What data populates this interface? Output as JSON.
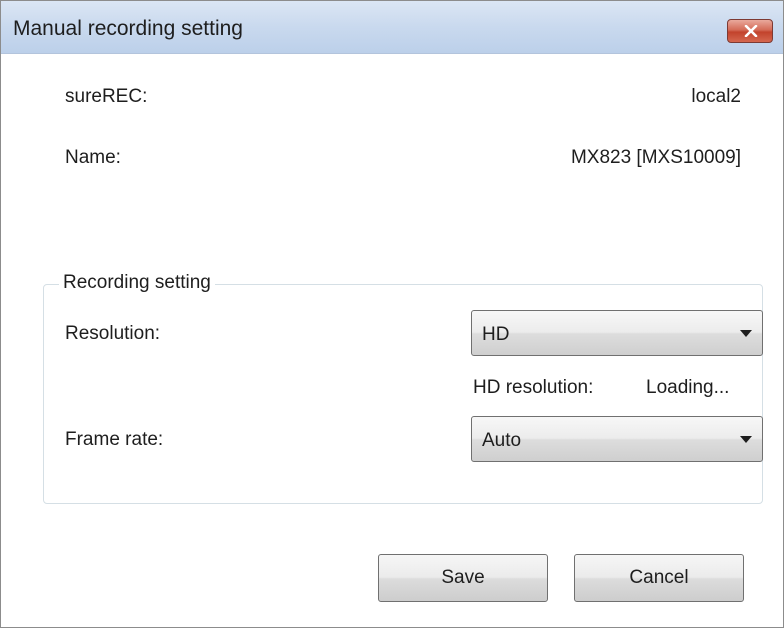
{
  "window": {
    "title": "Manual recording setting"
  },
  "info": {
    "surerec_label": "sureREC:",
    "surerec_value": "local2",
    "name_label": "Name:",
    "name_value": "MX823 [MXS10009]"
  },
  "recording": {
    "group_title": "Recording setting",
    "resolution_label": "Resolution:",
    "resolution_value": "HD",
    "hd_resolution_label": "HD resolution:",
    "hd_resolution_value": "Loading...",
    "frame_rate_label": "Frame rate:",
    "frame_rate_value": "Auto"
  },
  "buttons": {
    "save_label": "Save",
    "cancel_label": "Cancel"
  },
  "icons": {
    "close": "close-icon",
    "dropdown": "chevron-down-icon"
  },
  "colors": {
    "close_button": "#c2432c",
    "titlebar": "#c9d9ee"
  }
}
